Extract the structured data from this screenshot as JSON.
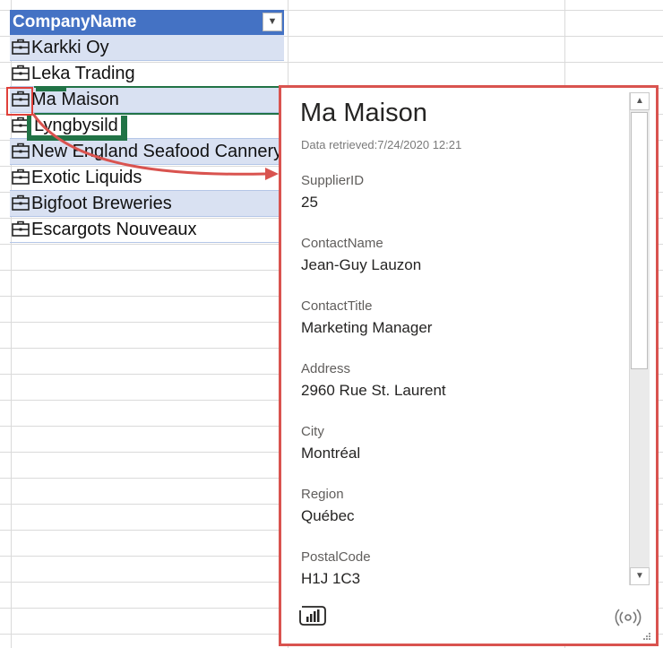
{
  "table": {
    "header": "CompanyName",
    "filter_icon": "dropdown-arrow-icon",
    "rows": [
      "Karkki Oy",
      "Leka Trading",
      "Ma Maison",
      "Lyngbysild",
      "New England Seafood Cannery",
      "Exotic Liquids",
      "Bigfoot Breweries",
      "Escargots Nouveaux"
    ],
    "row_icon": "briefcase-icon"
  },
  "card": {
    "title": "Ma Maison",
    "retrieved": "Data retrieved:7/24/2020 12:21",
    "fields": [
      {
        "label": "SupplierID",
        "value": "25"
      },
      {
        "label": "ContactName",
        "value": "Jean-Guy Lauzon"
      },
      {
        "label": "ContactTitle",
        "value": "Marketing Manager"
      },
      {
        "label": "Address",
        "value": "2960 Rue St. Laurent"
      },
      {
        "label": "City",
        "value": "Montréal"
      },
      {
        "label": "Region",
        "value": "Québec"
      },
      {
        "label": "PostalCode",
        "value": "H1J 1C3"
      }
    ],
    "footer_left_icon": "power-bi-icon",
    "footer_right_icon": "broadcast-icon"
  },
  "colors": {
    "header_bg": "#4472c4",
    "band_bg": "#d9e1f2",
    "highlight_red": "#d9534f",
    "excel_green": "#217346"
  }
}
